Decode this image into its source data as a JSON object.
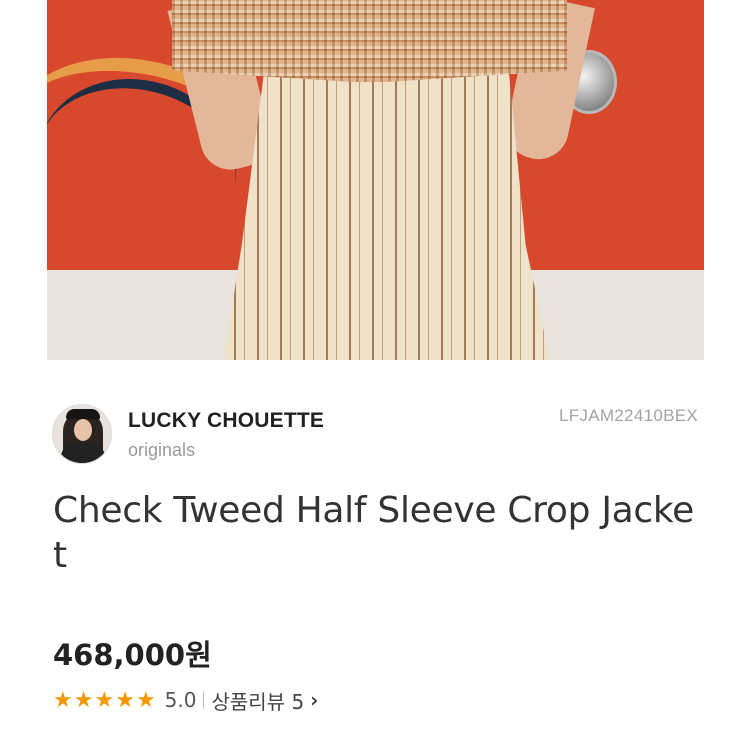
{
  "product": {
    "brand": "LUCKY CHOUETTE",
    "sub_brand": "originals",
    "product_code": "LFJAM22410BEX",
    "title": "Check Tweed Half Sleeve Crop Jacket",
    "price": "468,000원",
    "rating": {
      "stars": 5,
      "max_stars": 5,
      "score": "5.0",
      "reviews_label": "상품리뷰 5"
    }
  },
  "icons": {
    "star": "star-icon",
    "chevron": "chevron-right-icon"
  },
  "colors": {
    "star": "#f39800",
    "muted_text": "#9a9a9a"
  },
  "glyphs": {
    "star": "★",
    "chevron": "›"
  }
}
